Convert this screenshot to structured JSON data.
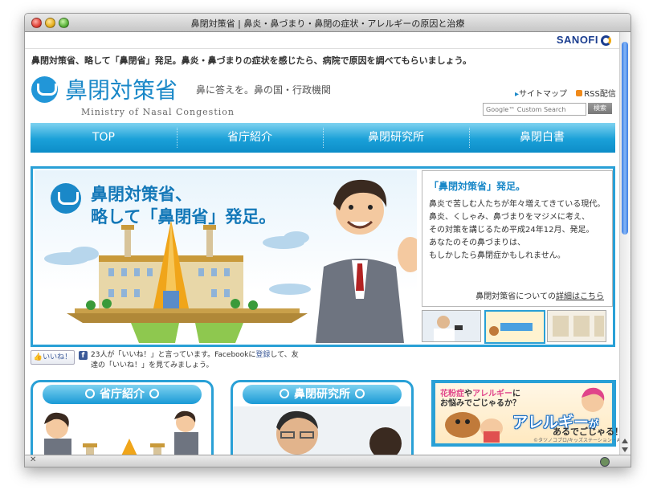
{
  "window": {
    "title": "鼻閉対策省 | 鼻炎・鼻づまり・鼻閉の症状・アレルギーの原因と治療"
  },
  "sponsor": {
    "brand": "SANOFI"
  },
  "tagline": "鼻閉対策省、略して「鼻閉省」発足。鼻炎・鼻づまりの症状を感じたら、病院で原因を調べてもらいましょう。",
  "logo": {
    "name": "鼻閉対策省",
    "catch": "鼻に答えを。鼻の国・行政機関",
    "english": "Ministry of Nasal Congestion"
  },
  "toplinks": {
    "sitemap": "サイトマップ",
    "rss": "RSS配信"
  },
  "search": {
    "placeholder": "Google™ Custom Search",
    "button": "検索"
  },
  "nav": {
    "items": [
      "TOP",
      "省庁紹介",
      "鼻閉研究所",
      "鼻閉白書"
    ]
  },
  "hero": {
    "title_line1": "鼻閉対策省、",
    "title_line2": "略して「鼻閉省」発足。",
    "box_title": "「鼻閉対策省」発足。",
    "body": [
      "鼻炎で苦しむ人たちが年々増えてきている現代。",
      "鼻炎、くしゃみ、鼻づまりをマジメに考え、",
      "その対策を講じるため平成24年12月、発足。",
      "あなたのその鼻づまりは、",
      "もしかしたら鼻閉症かもしれません。"
    ],
    "more_prefix": "鼻閉対策省についての",
    "more_link": "詳細はこちら"
  },
  "facebook": {
    "like_button": "いいね！",
    "line1_a": "23人が「いいね！」と言っています。Facebookに",
    "line1_link": "登録",
    "line1_b": "して、友",
    "line2": "達の「いいね！」を見てみましょう。"
  },
  "panels": [
    {
      "title": "省庁紹介"
    },
    {
      "title": "鼻閉研究所"
    }
  ],
  "banner": {
    "line1_a": "花粉症",
    "line1_b": "や",
    "line1_c": "アレルギー",
    "line1_d": "に",
    "line2": "お悩みでごじゃるか？",
    "big": "アレルギー",
    "big_suffix": "が",
    "tail": "あるでごじゃる！",
    "credit": "©タツノコプロ/キッズステーション・AGP"
  },
  "colors": {
    "accent": "#29a0d6",
    "brand": "#1a88c8",
    "nav_start": "#7fd2f0",
    "nav_end": "#0d8dc8"
  },
  "icons": [
    "close-icon",
    "minimize-icon",
    "zoom-icon",
    "rss-icon",
    "facebook-icon",
    "ministry-logo-icon"
  ]
}
